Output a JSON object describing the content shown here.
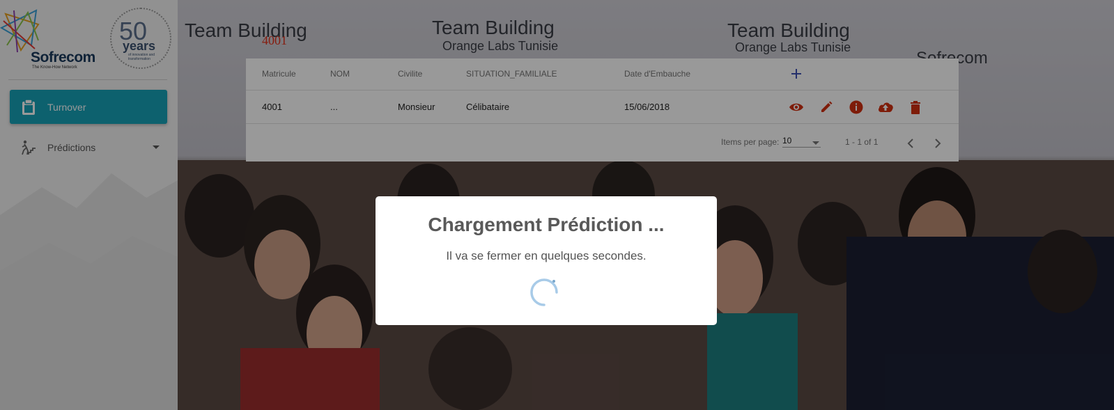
{
  "sidebar": {
    "logo": {
      "brand": "Sofrecom",
      "tagline": "The Know-How Network"
    },
    "anniversary": {
      "number": "50",
      "word": "years",
      "tagline": "of innovation and transformation"
    },
    "items": [
      {
        "label": "Turnover",
        "icon": "clipboard-icon",
        "active": true
      },
      {
        "label": "Prédictions",
        "icon": "person-stairs-icon",
        "active": false,
        "expandable": true
      }
    ]
  },
  "background": {
    "banner_title": "Team Building",
    "banner_subtitle": "Orange Labs Tunisie",
    "banner_brand": "Sofrecom"
  },
  "selected_id": "4001",
  "table": {
    "columns": [
      "Matricule",
      "NOM",
      "Civilite",
      "SITUATION_FAMILIALE",
      "Date d'Embauche"
    ],
    "rows": [
      {
        "matricule": "4001",
        "nom": "...",
        "civilite": "Monsieur",
        "situation": "Célibataire",
        "date": "15/06/2018"
      }
    ],
    "row_actions": [
      "view-icon",
      "edit-icon",
      "info-icon",
      "upload-icon",
      "delete-icon"
    ],
    "action_color": "#d32f0f",
    "add_color": "#3f51b5"
  },
  "paginator": {
    "items_per_page_label": "Items per page:",
    "page_size": "10",
    "range": "1 - 1 of 1"
  },
  "modal": {
    "title": "Chargement Prédiction ...",
    "text": "Il va se fermer en quelques secondes.",
    "spinner_color": "#a8cbe8"
  },
  "colors": {
    "accent": "#17a2b8"
  }
}
